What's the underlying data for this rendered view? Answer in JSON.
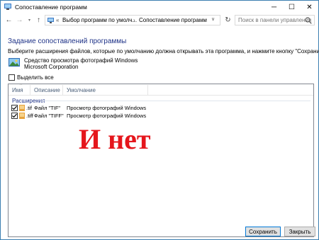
{
  "window": {
    "title": "Сопоставление программ",
    "controls": {
      "minimize": "─",
      "maximize": "☐",
      "close": "✕"
    }
  },
  "nav": {
    "back": "←",
    "forward": "→",
    "recent": "▾",
    "up": "↑",
    "breadcrumb_lead": "«",
    "crumb1": "Выбор программ по умолч...",
    "separator": "›",
    "crumb2": "Сопоставление программ",
    "dropdown": "∨",
    "refresh": "↻",
    "search_placeholder": "Поиск в панели управления"
  },
  "main": {
    "heading": "Задание сопоставлений программы",
    "instruction": "Выберите расширения файлов, которые по умолчанию должна открывать эта программа, и нажмите кнопку \"Сохранить\".",
    "program_name": "Средство просмотра фотографий Windows",
    "program_company": "Microsoft Corporation",
    "select_all_label": "Выделить все"
  },
  "list": {
    "columns": [
      "Имя",
      "Описание",
      "Умолчание"
    ],
    "group": "Расширения",
    "rows": [
      {
        "name": ".tif",
        "description": "Файл \"TIF\"",
        "default": "Просмотр фотографий Windows",
        "checked": true
      },
      {
        "name": ".tiff",
        "description": "Файл \"TIFF\"",
        "default": "Просмотр фотографий Windows",
        "checked": true
      }
    ]
  },
  "overlay_text": "И нет",
  "buttons": {
    "save": "Сохранить",
    "close": "Закрыть"
  },
  "colors": {
    "heading": "#1e3287",
    "overlay": "#e5161c",
    "accent": "#0078d7"
  }
}
